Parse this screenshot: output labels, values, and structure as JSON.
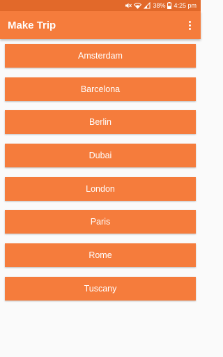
{
  "status_bar": {
    "battery": "38%",
    "time": "4:25 pm",
    "icons": [
      "mute-icon",
      "wifi-icon",
      "signal-icon",
      "battery-icon"
    ]
  },
  "app_bar": {
    "title": "Make Trip",
    "overflow_icon": "more-vert-icon"
  },
  "colors": {
    "status_bar": "#e2692a",
    "primary": "#f57c3c",
    "background": "#fafafa",
    "text_on_primary": "#ffffff"
  },
  "cities": [
    {
      "label": "Amsterdam"
    },
    {
      "label": "Barcelona"
    },
    {
      "label": "Berlin"
    },
    {
      "label": "Dubai"
    },
    {
      "label": "London"
    },
    {
      "label": "Paris"
    },
    {
      "label": "Rome"
    },
    {
      "label": "Tuscany"
    }
  ]
}
